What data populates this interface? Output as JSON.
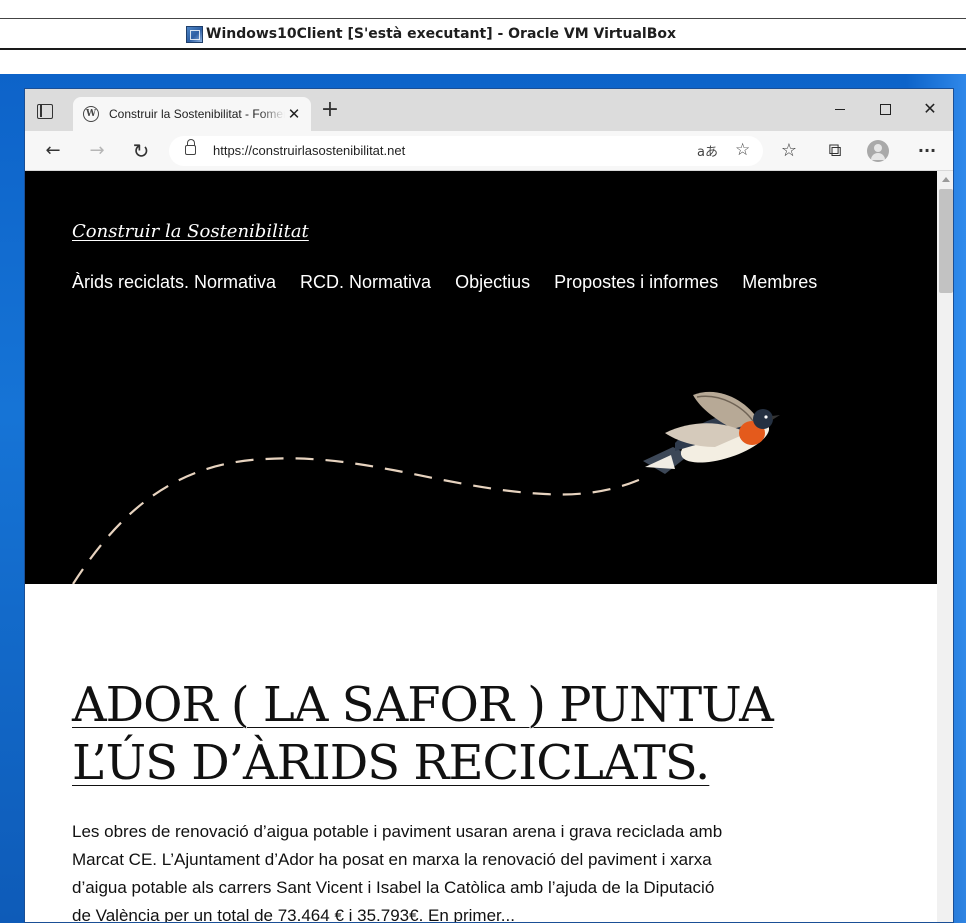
{
  "host": {
    "title": "Windows10Client [S'està executant] - Oracle VM VirtualBox"
  },
  "browser": {
    "tab": {
      "title": "Construir la Sostenibilitat - Fomentem la sostenibilitat",
      "favicon": "wordpress-icon"
    },
    "address": {
      "url": "https://construirlasostenibilitat.net"
    },
    "read_aloud_glyph": "aあ"
  },
  "site": {
    "title": "Construir la Sostenibilitat",
    "nav": [
      {
        "label": "Àrids reciclats. Normativa"
      },
      {
        "label": "RCD. Normativa"
      },
      {
        "label": "Objectius"
      },
      {
        "label": "Propostes i informes"
      },
      {
        "label": "Membres"
      }
    ]
  },
  "post": {
    "title": "ADOR ( LA SAFOR ) PUNTUA L’ÚS D’ÀRIDS RECICLATS.",
    "excerpt": "Les obres de renovació d’aigua potable i paviment usaran arena i grava reciclada amb Marcat CE. L’Ajuntament d’Ador ha posat en marxa la renovació del paviment i xarxa d’aigua potable als carrers Sant Vicent i Isabel la Catòlica amb l’ajuda de la Diputació de València per un total de 73.464 € i 35.793€. En primer..."
  },
  "colors": {
    "hero_bg": "#000000",
    "desktop_blue": "#0d63c9",
    "flight_path": "#e7d3bf",
    "bird_breast": "#e45a1c"
  }
}
